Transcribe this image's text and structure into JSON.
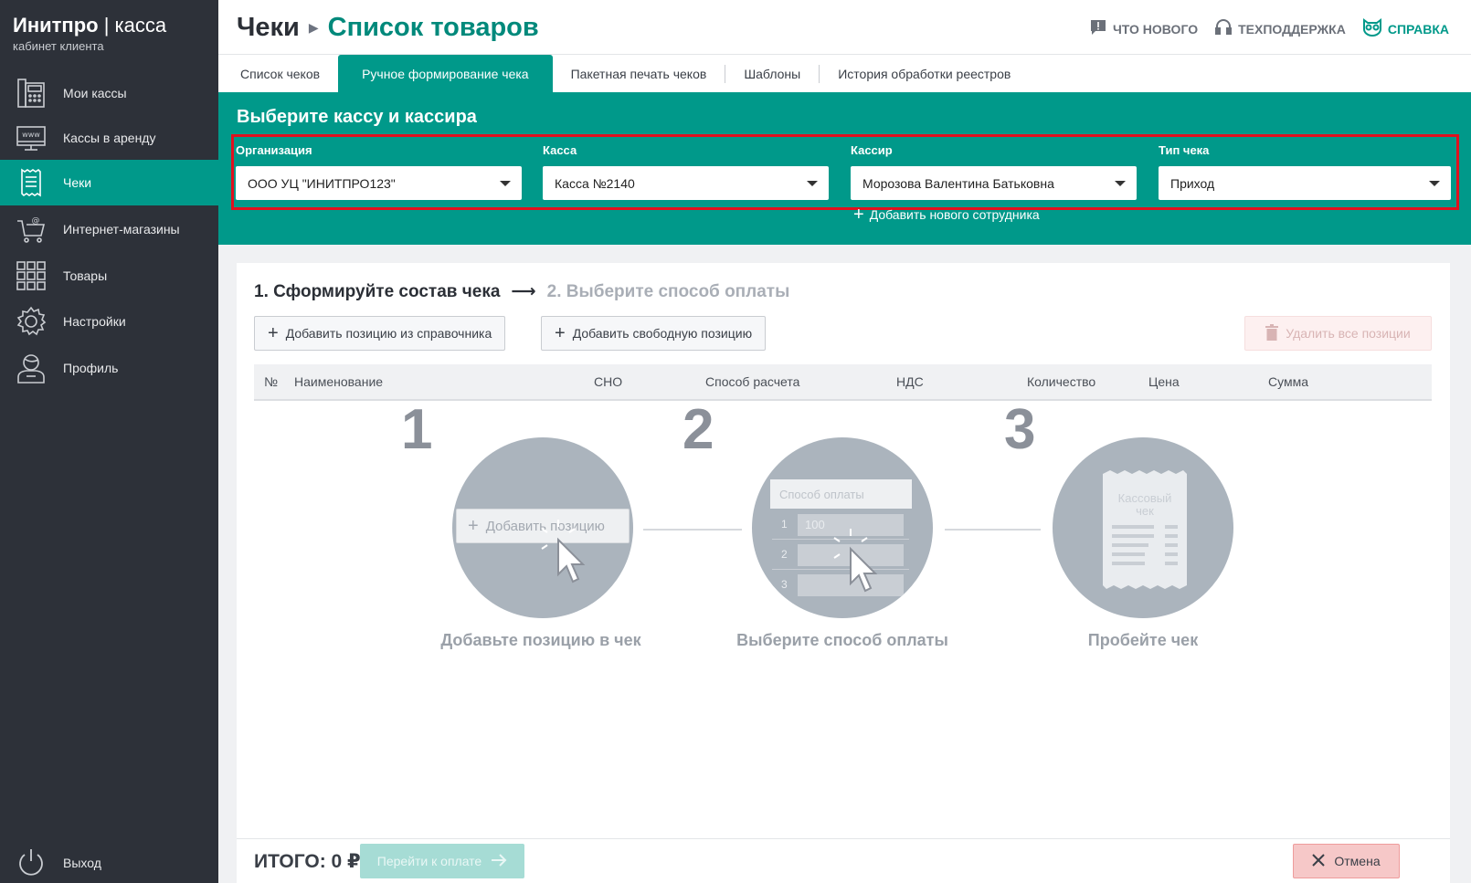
{
  "logo": {
    "brand": "Инитпро",
    "separator": "|",
    "product": "касса",
    "subtitle": "кабинет клиента"
  },
  "sidebar": {
    "items": [
      {
        "label": "Мои кассы",
        "icon": "cash-register-icon"
      },
      {
        "label": "Кассы в аренду",
        "icon": "web-monitor-icon"
      },
      {
        "label": "Чеки",
        "icon": "receipt-icon",
        "active": true
      },
      {
        "label": "Интернет-магазины",
        "icon": "shopping-cart-icon"
      },
      {
        "label": "Товары",
        "icon": "grid-icon"
      },
      {
        "label": "Настройки",
        "icon": "gear-icon"
      },
      {
        "label": "Профиль",
        "icon": "user-icon"
      }
    ],
    "logout": "Выход"
  },
  "header": {
    "crumb_root": "Чеки",
    "crumb_current": "Список товаров",
    "links": {
      "whats_new": "ЧТО НОВОГО",
      "support": "ТЕХПОДДЕРЖКА",
      "help": "СПРАВКА"
    }
  },
  "tabs": [
    "Список чеков",
    "Ручное формирование чека",
    "Пакетная печать чеков",
    "Шаблоны",
    "История обработки реестров"
  ],
  "panel": {
    "title": "Выберите кассу и кассира",
    "org_label": "Организация",
    "org_value": "ООО УЦ \"ИНИТПРО123\"",
    "kassa_label": "Касса",
    "kassa_value": "Касса №2140",
    "cashier_label": "Кассир",
    "cashier_value": "Морозова Валентина Батьковна",
    "type_label": "Тип чека",
    "type_value": "Приход",
    "add_employee": "Добавить нового сотрудника"
  },
  "main": {
    "step1": "1. Сформируйте состав чека",
    "step2": "2. Выберите способ оплаты",
    "add_from_catalog": "Добавить позицию из справочника",
    "add_free": "Добавить свободную позицию",
    "delete_all": "Удалить все позиции",
    "columns": [
      "№",
      "Наименование",
      "СНО",
      "Способ расчета",
      "НДС",
      "Количество",
      "Цена",
      "Сумма"
    ],
    "illustration": {
      "num1": "1",
      "num2": "2",
      "num3": "3",
      "add_position": "Добавить позицию",
      "payment_method": "Способ оплаты",
      "rows": [
        "1",
        "2",
        "3"
      ],
      "sample_value": "100",
      "receipt_title": "Кассовый",
      "receipt_sub": "чек",
      "caption1": "Добавьте позицию в чек",
      "caption2": "Выберите способ оплаты",
      "caption3": "Пробейте чек"
    }
  },
  "footer": {
    "total": "ИТОГО: 0 ₽",
    "pay": "Перейти к оплате",
    "cancel": "Отмена"
  }
}
